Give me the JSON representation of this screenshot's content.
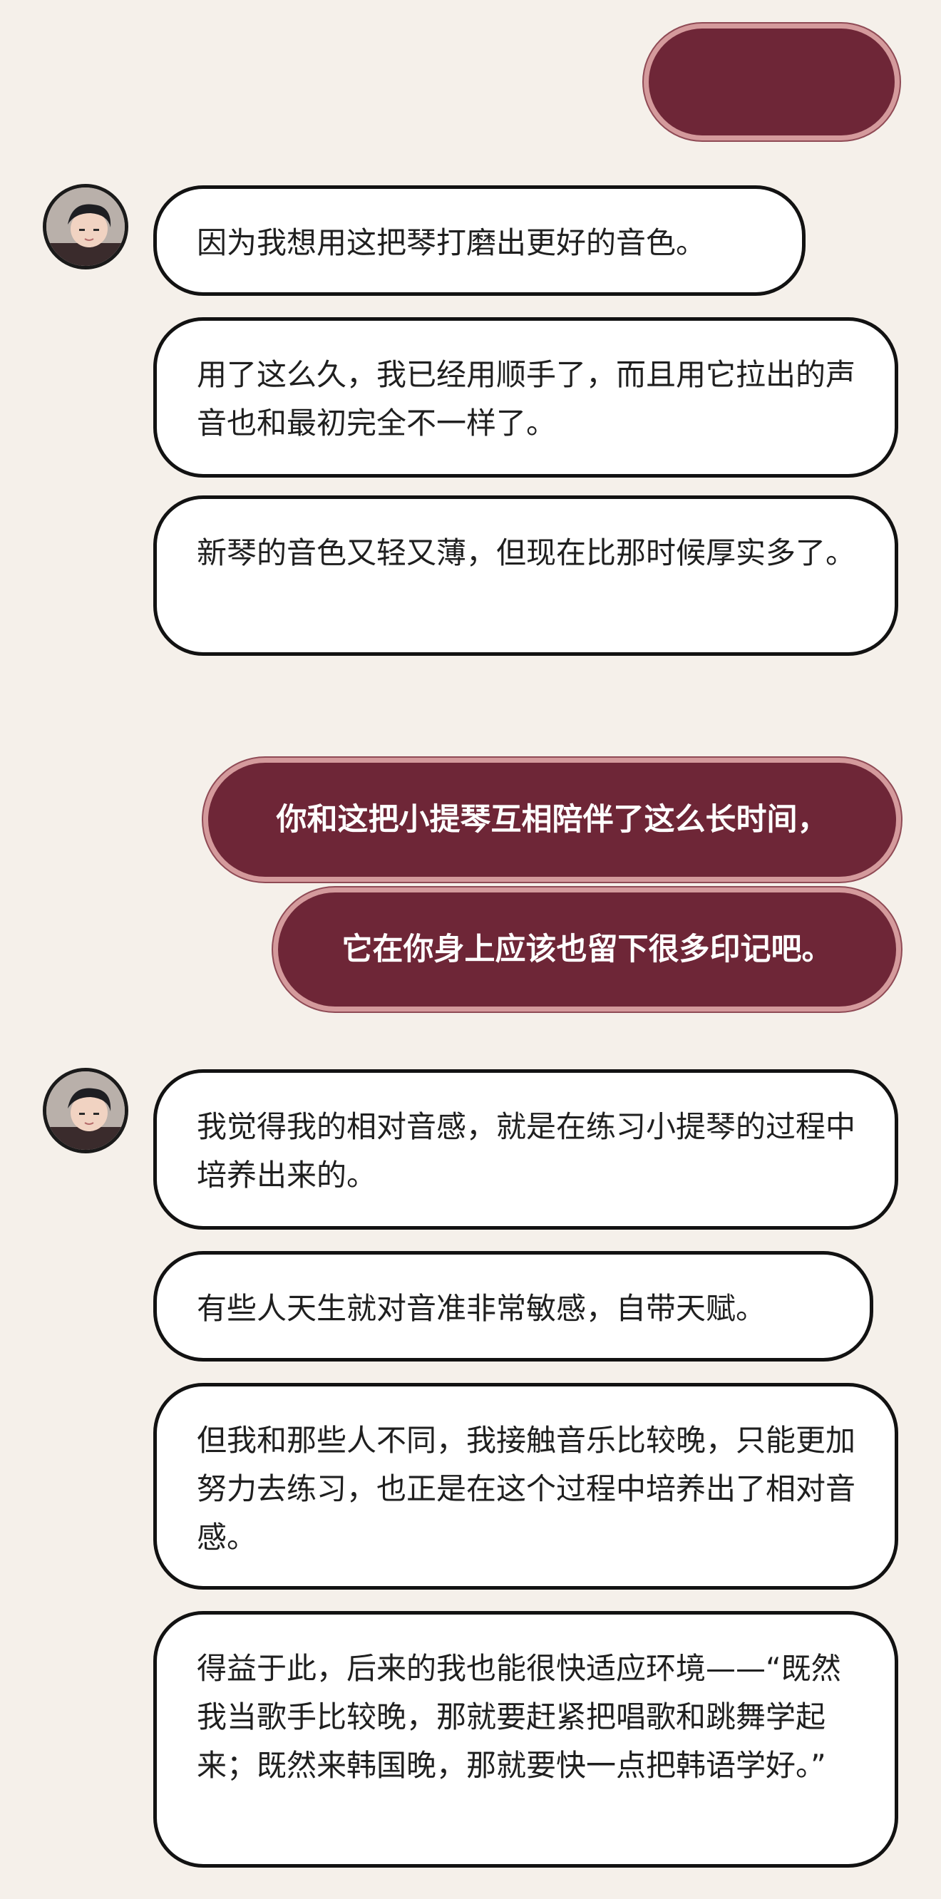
{
  "messages": {
    "top_right_bubble": "",
    "left_block_1": [
      "因为我想用这把琴打磨出更好的音色。",
      "用了这么久，我已经用顺手了，而且用它拉出的声音也和最初完全不一样了。",
      "新琴的音色又轻又薄，但现在比那时候厚实多了。"
    ],
    "right_block": [
      "你和这把小提琴互相陪伴了这么长时间，",
      "它在你身上应该也留下很多印记吧。"
    ],
    "left_block_2": [
      "我觉得我的相对音感，就是在练习小提琴的过程中培养出来的。",
      "有些人天生就对音准非常敏感，自带天赋。",
      "但我和那些人不同，我接触音乐比较晚，只能更加努力去练习，也正是在这个过程中培养出了相对音感。",
      "得益于此，后来的我也能很快适应环境——“既然我当歌手比较晚，那就要赶紧把唱歌和跳舞学起来；既然来韩国晚，那就要快一点把韩语学好。”"
    ]
  },
  "colors": {
    "background": "#f5f0ea",
    "right_bubble": "#6e2637",
    "right_bubble_outline": "#d49a9c",
    "left_bubble_fill": "#ffffff",
    "left_bubble_outline": "#121212"
  },
  "icons": {
    "avatar": "avatar-icon"
  }
}
